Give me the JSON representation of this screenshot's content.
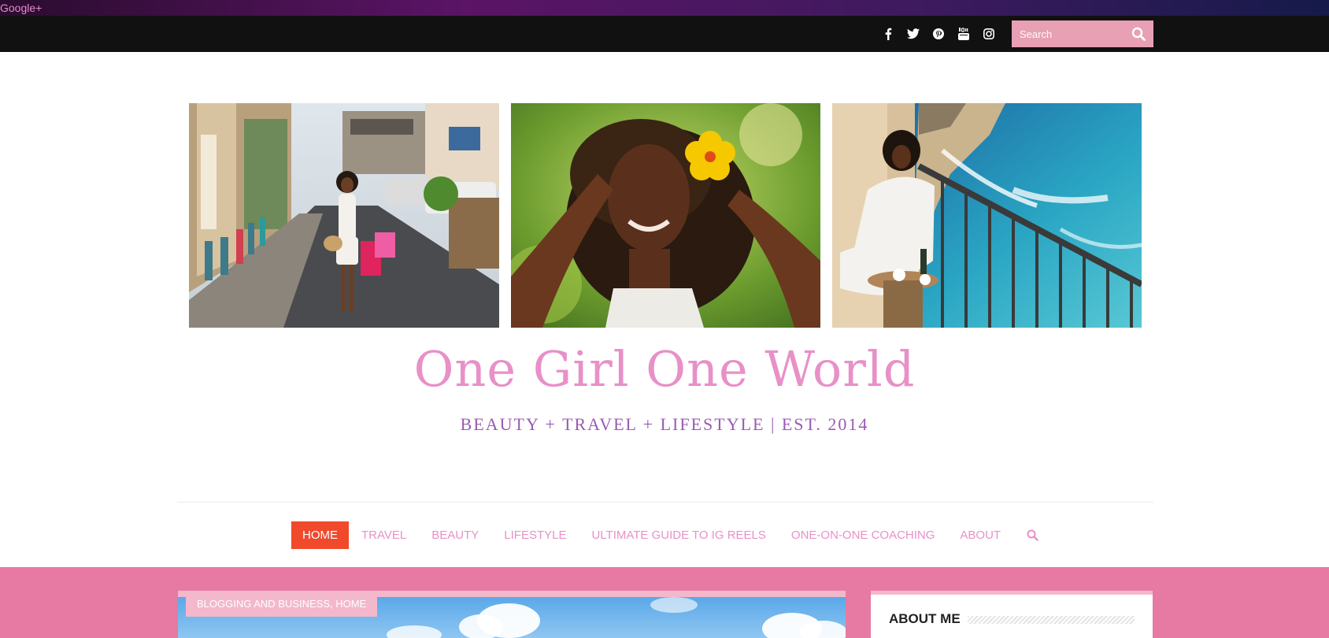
{
  "top_bar": {
    "gplus_label": "Google+"
  },
  "social": {
    "icons": [
      "facebook-icon",
      "twitter-icon",
      "pinterest-icon",
      "youtube-icon",
      "instagram-icon"
    ],
    "search_placeholder": "Search"
  },
  "header": {
    "title": "One Girl One World",
    "tagline": "BEAUTY +  TRAVEL + LIFESTYLE | EST. 2014"
  },
  "nav": {
    "items": [
      {
        "label": "HOME",
        "active": true
      },
      {
        "label": "TRAVEL"
      },
      {
        "label": "BEAUTY"
      },
      {
        "label": "LIFESTYLE"
      },
      {
        "label": "ULTIMATE GUIDE TO IG REELS"
      },
      {
        "label": "ONE-ON-ONE COACHING"
      },
      {
        "label": "ABOUT"
      }
    ]
  },
  "featured_post": {
    "category": "BLOGGING AND BUSINESS, HOME"
  },
  "sidebar": {
    "widget_title": "ABOUT ME"
  },
  "colors": {
    "accent_pink": "#e890c8",
    "band_pink": "#e67aa2",
    "nav_active": "#f0492b",
    "tagline_purple": "#9a5ab4"
  }
}
